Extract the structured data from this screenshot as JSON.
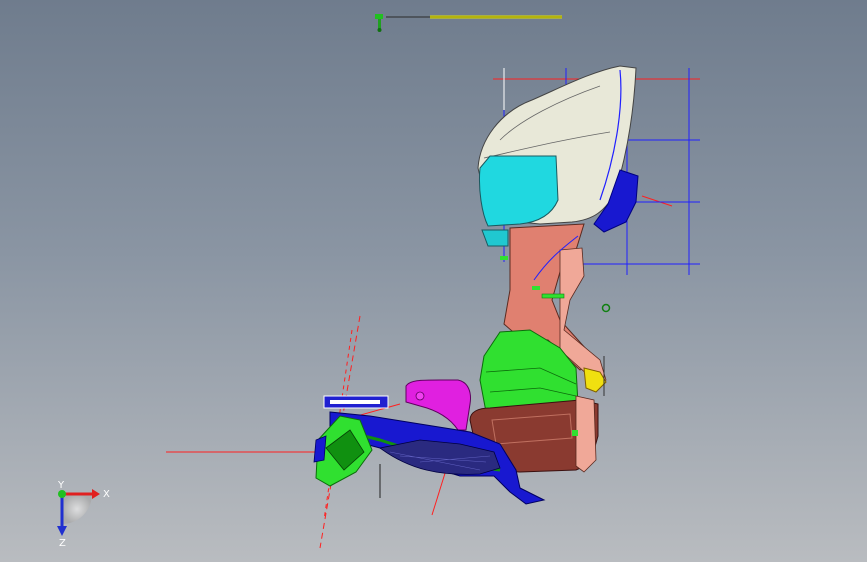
{
  "viewport": {
    "background_top": "#6f7c8d",
    "background_bottom": "#b9bcc0"
  },
  "triad": {
    "x_label": "X",
    "y_label": "Y",
    "z_label": "Z",
    "x_color": "#e02020",
    "y_color": "#20c020",
    "z_color": "#2030d0"
  },
  "top_scale": {
    "icon": "pin-icon",
    "bar_color": "#e0e000"
  },
  "model": {
    "icon": "cad-assembly",
    "colors": {
      "shell": "#e8e8d8",
      "cyan": "#20d8e0",
      "salmon": "#e08070",
      "green": "#30e030",
      "magenta": "#e020e0",
      "brown": "#8a3a30",
      "blue": "#1818d0",
      "yellow": "#f0e010",
      "dark_green": "#109010",
      "red_line": "#ff2020",
      "blue_line": "#2020ff"
    }
  }
}
